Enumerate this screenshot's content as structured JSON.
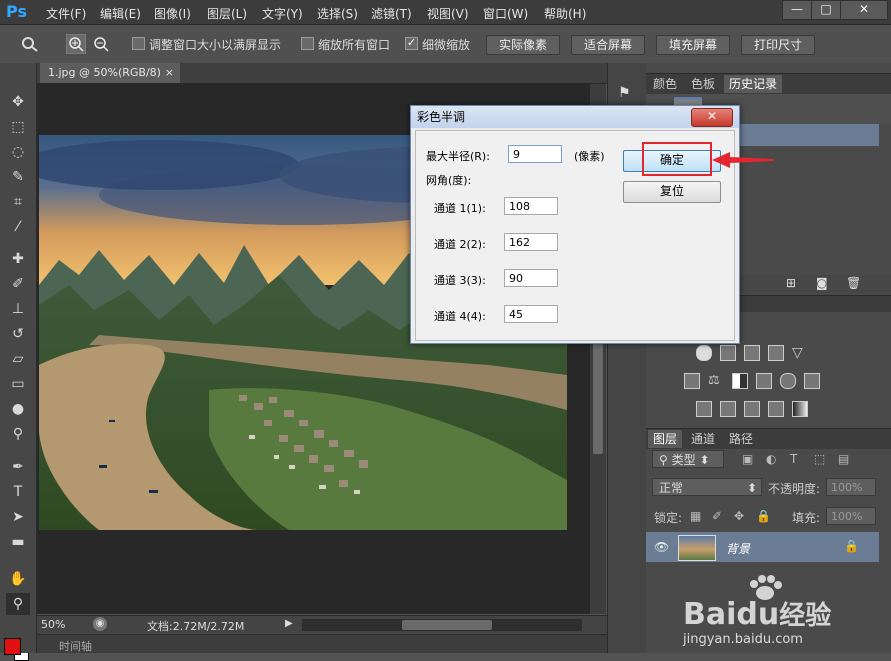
{
  "app": {
    "logo": "Ps"
  },
  "menu": [
    "文件(F)",
    "编辑(E)",
    "图像(I)",
    "图层(L)",
    "文字(Y)",
    "选择(S)",
    "滤镜(T)",
    "视图(V)",
    "窗口(W)",
    "帮助(H)"
  ],
  "window_controls": {
    "minimize": "—",
    "maximize": "□",
    "close": "✕"
  },
  "options": {
    "resize_windows_label": "调整窗口大小以满屏显示",
    "zoom_all_label": "缩放所有窗口",
    "scrubby_zoom_label": "细微缩放",
    "actual_pixels": "实际像素",
    "fit_screen": "适合屏幕",
    "fill_screen": "填充屏幕",
    "print_size": "打印尺寸"
  },
  "document": {
    "tab_label": "1.jpg @ 50%(RGB/8)",
    "tab_close": "×",
    "zoom": "50%",
    "doc_size": "文档:2.72M/2.72M"
  },
  "timeline": {
    "label": "时间轴"
  },
  "panels": {
    "top_tabs": [
      "颜色",
      "色板",
      "历史记录"
    ],
    "layer_tabs": [
      "图层",
      "通道",
      "路径"
    ],
    "filter_kind": "类型",
    "blend_mode": "正常",
    "opacity_label": "不透明度:",
    "opacity_value": "100%",
    "lock_label": "锁定:",
    "fill_label": "填充:",
    "fill_value": "100%",
    "layer_name": "背景"
  },
  "dialog": {
    "title": "彩色半调",
    "close": "✕",
    "max_radius_label": "最大半径(R):",
    "max_radius_value": "9",
    "max_radius_unit": "(像素)",
    "screen_angle_label": "网角(度):",
    "channels": [
      {
        "label": "通道 1(1):",
        "value": "108"
      },
      {
        "label": "通道 2(2):",
        "value": "162"
      },
      {
        "label": "通道 3(3):",
        "value": "90"
      },
      {
        "label": "通道 4(4):",
        "value": "45"
      }
    ],
    "ok_button": "确定",
    "reset_button": "复位"
  },
  "watermark": {
    "brand": "Bai",
    "brand2": "du",
    "brand3": "经验",
    "url": "jingyan.baidu.com"
  },
  "colors": {
    "foreground": "#e01010",
    "background": "#ffffff",
    "highlight": "#e5252f"
  }
}
